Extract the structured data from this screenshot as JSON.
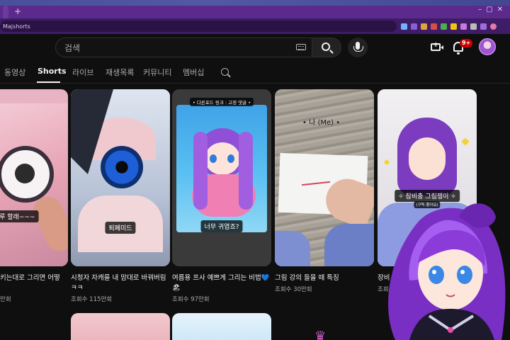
{
  "browser": {
    "new_tab_label": "+",
    "url": "Majshorts"
  },
  "header": {
    "search_placeholder": "검색",
    "notification_count": "9+"
  },
  "tabs": [
    {
      "label": "동영상",
      "active": false
    },
    {
      "label": "Shorts",
      "active": true
    },
    {
      "label": "라이브",
      "active": false
    },
    {
      "label": "재생목록",
      "active": false
    },
    {
      "label": "커뮤니티",
      "active": false
    },
    {
      "label": "멤버십",
      "active": false
    }
  ],
  "cards": [
    {
      "caption": "망대루 할래~~~",
      "title": "키는대로 그리면 어떻",
      "views": "만회"
    },
    {
      "caption": "퇴폐미드",
      "title": "시청자 자캐를 내 맘대로 바꿔버림",
      "title2": "ㅋㅋ",
      "views": "조회수 115만회"
    },
    {
      "top_caption": "• 다른포드 링크 : 고정 댓글 •",
      "caption": "너무 귀엽죠?",
      "title": "여름용 프사 예쁘게 그리는 비법💙",
      "title2": "🏖",
      "views": "조회수 97만회"
    },
    {
      "top_caption": "• 나 (Me) •",
      "title": "그림 강의 들을 때 특징",
      "views": "조회수 30만회"
    },
    {
      "overlay_caption": "✧ 잠비충 그림쟁이 ✧",
      "overlay_sub": "(구독·좋아요)",
      "title": "장비 없으면 못",
      "views": "조회수 46"
    }
  ],
  "colors": {
    "background": "#0f0f0f",
    "browser_frame": "#5b2a8c",
    "badge": "#cc0000"
  }
}
